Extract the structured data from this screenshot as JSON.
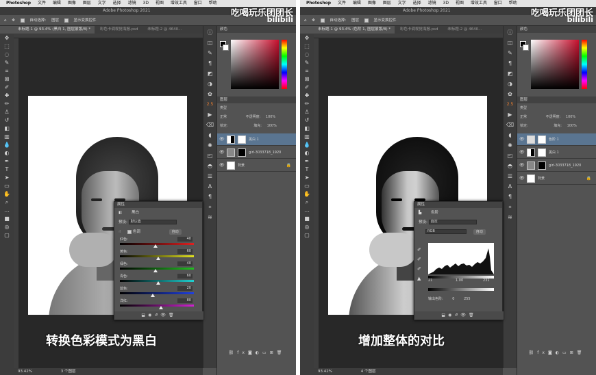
{
  "menubar": {
    "apple": "",
    "app": "Photoshop",
    "items": [
      "文件",
      "编辑",
      "图像",
      "图层",
      "文字",
      "选择",
      "滤镜",
      "3D",
      "视图",
      "增效工具",
      "窗口",
      "帮助"
    ]
  },
  "window_title": "Adobe Photoshop 2021",
  "watermark": {
    "text": "吃喝玩乐团团长",
    "brand": "bilibili"
  },
  "options": {
    "auto_select": "自动选择:",
    "layer_select": "图层",
    "show_transform": "显示变换控件"
  },
  "left": {
    "tabs": [
      "未标题-1 @ 93.4% (黑白 1, 图层蒙版/8) *",
      "彩色卡调视觉海报.psd",
      "未标题-2 @ 4640..."
    ],
    "subtitle": "转换色彩模式为黑白",
    "status": {
      "zoom": "93.42%",
      "layers": "3 个图层"
    },
    "layers": [
      {
        "name": "黑白 1",
        "selected": true
      },
      {
        "name": "girl-3033718_1920",
        "selected": false
      },
      {
        "name": "背景",
        "selected": false,
        "locked": true
      }
    ],
    "properties": {
      "title": "属性",
      "type_label": "黑白",
      "preset_label": "预设:",
      "preset_value": "默认值",
      "tint_label": "色调",
      "auto_button": "自动",
      "sliders": [
        {
          "label": "红色:",
          "value": 40,
          "grad": "linear-gradient(90deg,#000,#e02020)"
        },
        {
          "label": "黄色:",
          "value": 60,
          "grad": "linear-gradient(90deg,#000,#e0e020)"
        },
        {
          "label": "绿色:",
          "value": 40,
          "grad": "linear-gradient(90deg,#000,#20c020)"
        },
        {
          "label": "青色:",
          "value": 60,
          "grad": "linear-gradient(90deg,#000,#20d0d0)"
        },
        {
          "label": "蓝色:",
          "value": 20,
          "grad": "linear-gradient(90deg,#000,#2040e0)"
        },
        {
          "label": "洋红:",
          "value": 80,
          "grad": "linear-gradient(90deg,#000,#d020d0)"
        }
      ]
    }
  },
  "right": {
    "tabs": [
      "未标题-1 @ 93.4% (色阶 1, 图层蒙版/8) *",
      "彩色卡调视觉海报.psd",
      "未标题-2 @ 4640..."
    ],
    "subtitle": "增加整体的对比",
    "status": {
      "zoom": "93.42%",
      "layers": "4 个图层"
    },
    "layers": [
      {
        "name": "色阶 1",
        "selected": true
      },
      {
        "name": "黑白 1",
        "selected": false
      },
      {
        "name": "girl-3033718_1920",
        "selected": false
      },
      {
        "name": "背景",
        "selected": false,
        "locked": true
      }
    ],
    "properties": {
      "title": "属性",
      "type_label": "色阶",
      "preset_label": "预设:",
      "preset_value": "自定",
      "channel": "RGB",
      "auto_button": "自动",
      "input_black": "21",
      "input_mid": "1.00",
      "input_white": "231",
      "output_label": "输出色阶:",
      "output_black": "0",
      "output_white": "255"
    }
  },
  "panels": {
    "color": "颜色",
    "layers": "图层",
    "kind": "类型",
    "mode": "正常",
    "opacity_label": "不透明度:",
    "opacity": "100%",
    "lock_label": "锁定:",
    "fill_label": "填充:",
    "fill": "100%"
  },
  "number_2_5": "2.5"
}
